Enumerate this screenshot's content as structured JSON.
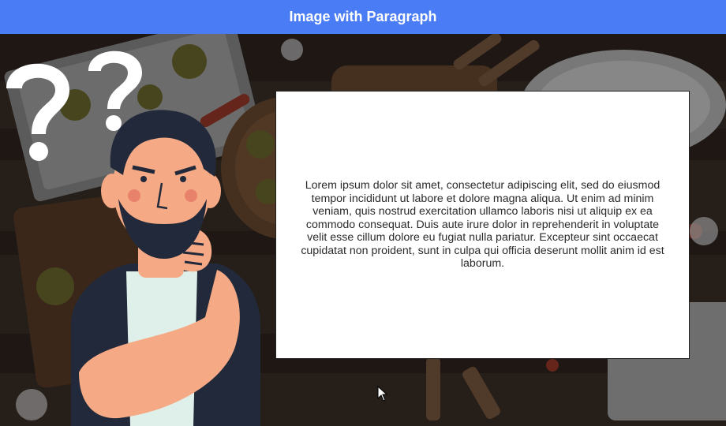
{
  "header": {
    "title": "Image with Paragraph",
    "background": "#4a7cf5"
  },
  "background_image": {
    "subject": "food-table-photo"
  },
  "illustration": {
    "subject": "thinking-man-with-question-marks"
  },
  "card": {
    "paragraph": "Lorem ipsum dolor sit amet, consectetur adipiscing elit, sed do eiusmod tempor incididunt ut labore et dolore magna aliqua. Ut enim ad minim veniam, quis nostrud exercitation ullamco laboris nisi ut aliquip ex ea commodo consequat. Duis aute irure dolor in reprehenderit in voluptate velit esse cillum dolore eu fugiat nulla pariatur. Excepteur sint occaecat cupidatat non proident, sunt in culpa qui officia deserunt mollit anim id est laborum."
  }
}
